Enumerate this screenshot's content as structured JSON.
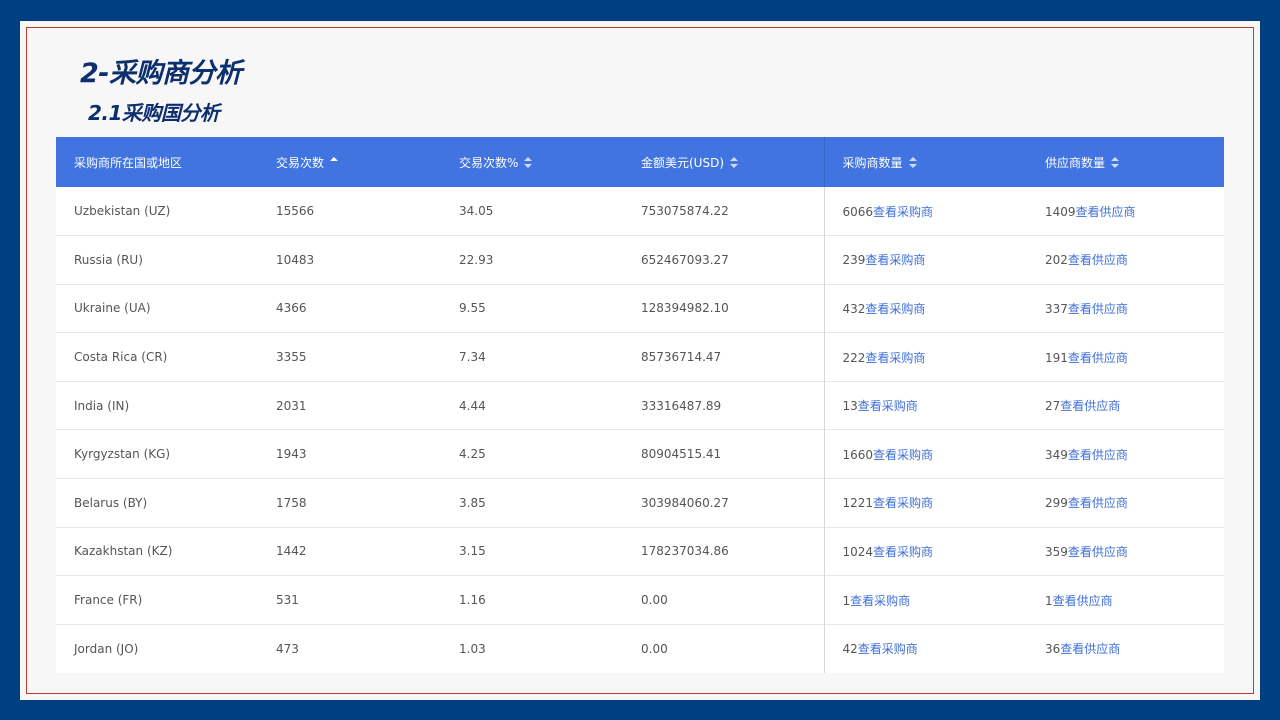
{
  "header": {
    "title": "2-采购商分析",
    "subtitle": "2.1采购国分析"
  },
  "table": {
    "columns": [
      {
        "label": "采购商所在国或地区",
        "sortable": false
      },
      {
        "label": "交易次数",
        "sortable": true,
        "sort_state": "asc"
      },
      {
        "label": "交易次数%",
        "sortable": true
      },
      {
        "label": "金额美元(USD)",
        "sortable": true
      },
      {
        "label": "采购商数量",
        "sortable": true
      },
      {
        "label": "供应商数量",
        "sortable": true
      }
    ],
    "rows": [
      {
        "country": "Uzbekistan (UZ)",
        "count": "15566",
        "pct": "34.05",
        "amount": "753075874.22",
        "buyers": "6066",
        "buyer_link": "查看采购商",
        "suppliers": "1409",
        "supplier_link": "查看供应商"
      },
      {
        "country": "Russia (RU)",
        "count": "10483",
        "pct": "22.93",
        "amount": "652467093.27",
        "buyers": "239",
        "buyer_link": "查看采购商",
        "suppliers": "202",
        "supplier_link": "查看供应商"
      },
      {
        "country": "Ukraine (UA)",
        "count": "4366",
        "pct": "9.55",
        "amount": "128394982.10",
        "buyers": "432",
        "buyer_link": "查看采购商",
        "suppliers": "337",
        "supplier_link": "查看供应商"
      },
      {
        "country": "Costa Rica (CR)",
        "count": "3355",
        "pct": "7.34",
        "amount": "85736714.47",
        "buyers": "222",
        "buyer_link": "查看采购商",
        "suppliers": "191",
        "supplier_link": "查看供应商"
      },
      {
        "country": "India (IN)",
        "count": "2031",
        "pct": "4.44",
        "amount": "33316487.89",
        "buyers": "13",
        "buyer_link": "查看采购商",
        "suppliers": "27",
        "supplier_link": "查看供应商"
      },
      {
        "country": "Kyrgyzstan (KG)",
        "count": "1943",
        "pct": "4.25",
        "amount": "80904515.41",
        "buyers": "1660",
        "buyer_link": "查看采购商",
        "suppliers": "349",
        "supplier_link": "查看供应商"
      },
      {
        "country": "Belarus (BY)",
        "count": "1758",
        "pct": "3.85",
        "amount": "303984060.27",
        "buyers": "1221",
        "buyer_link": "查看采购商",
        "suppliers": "299",
        "supplier_link": "查看供应商"
      },
      {
        "country": "Kazakhstan (KZ)",
        "count": "1442",
        "pct": "3.15",
        "amount": "178237034.86",
        "buyers": "1024",
        "buyer_link": "查看采购商",
        "suppliers": "359",
        "supplier_link": "查看供应商"
      },
      {
        "country": "France (FR)",
        "count": "531",
        "pct": "1.16",
        "amount": "0.00",
        "buyers": "1",
        "buyer_link": "查看采购商",
        "suppliers": "1",
        "supplier_link": "查看供应商"
      },
      {
        "country": "Jordan (JO)",
        "count": "473",
        "pct": "1.03",
        "amount": "0.00",
        "buyers": "42",
        "buyer_link": "查看采购商",
        "suppliers": "36",
        "supplier_link": "查看供应商"
      }
    ]
  },
  "colors": {
    "frame": "#003f82",
    "header_bg": "#4174e0",
    "link": "#3f6fd8",
    "title": "#0d2f6e"
  }
}
